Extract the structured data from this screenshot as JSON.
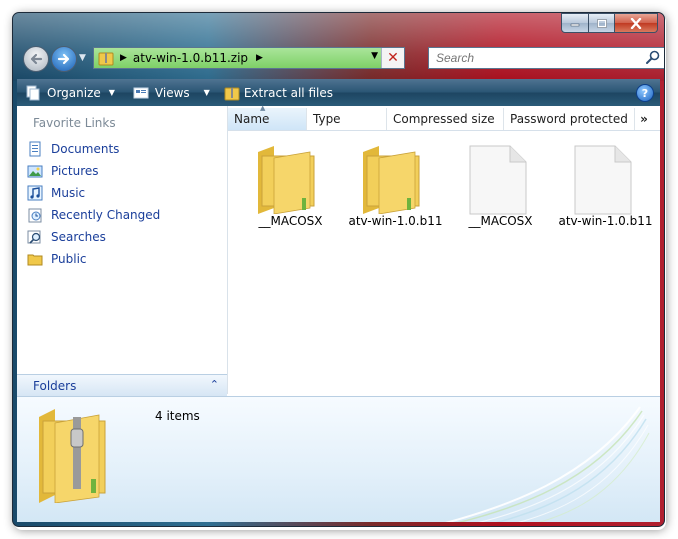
{
  "window": {
    "caption_buttons": [
      "minimize-icon",
      "maximize-icon",
      "close-icon"
    ]
  },
  "navigation": {
    "address_path": "atv-win-1.0.b11.zip",
    "search_placeholder": "Search"
  },
  "toolbar": {
    "organize_label": "Organize",
    "views_label": "Views",
    "extract_label": "Extract all files",
    "help_label": "?"
  },
  "sidebar": {
    "heading": "Favorite Links",
    "items": [
      {
        "label": "Documents",
        "icon": "documents-icon"
      },
      {
        "label": "Pictures",
        "icon": "pictures-icon"
      },
      {
        "label": "Music",
        "icon": "music-icon"
      },
      {
        "label": "Recently Changed",
        "icon": "recently-changed-icon"
      },
      {
        "label": "Searches",
        "icon": "searches-icon"
      },
      {
        "label": "Public",
        "icon": "public-folder-icon"
      }
    ],
    "folders_label": "Folders"
  },
  "columns": [
    "Name",
    "Type",
    "Compressed size",
    "Password protected",
    "»"
  ],
  "files": [
    {
      "name": "__MACOSX",
      "kind": "folder"
    },
    {
      "name": "atv-win-1.0.b11",
      "kind": "folder"
    },
    {
      "name": "__MACOSX",
      "kind": "file"
    },
    {
      "name": "atv-win-1.0.b11",
      "kind": "file"
    }
  ],
  "details": {
    "item_count": "4 items"
  },
  "colors": {
    "toolbar": "#2b5675",
    "address_bar": "#8ed879",
    "link_text": "#1a3e9a",
    "folder_yellow": "#f0c84a"
  }
}
